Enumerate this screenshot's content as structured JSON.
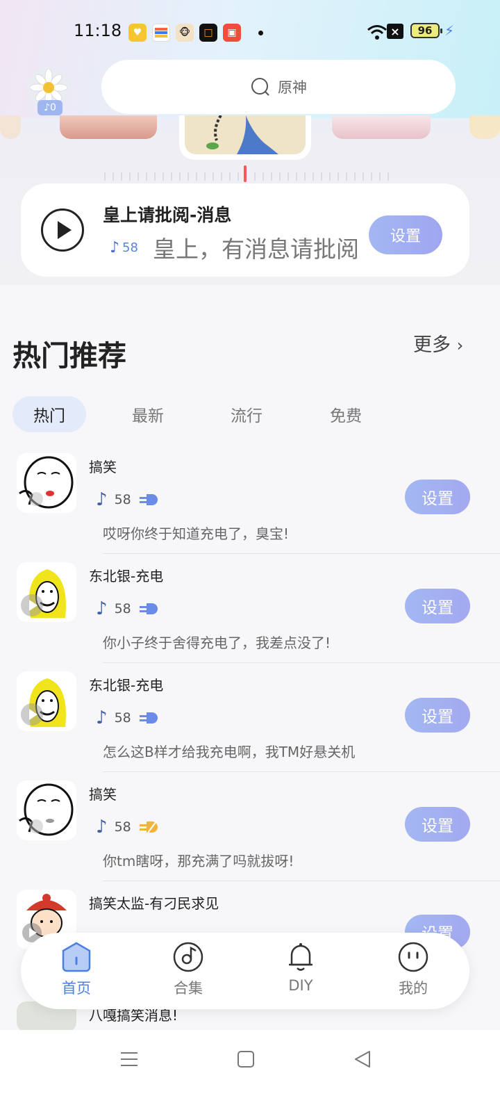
{
  "status_bar": {
    "time": "11:18",
    "battery": "96"
  },
  "avatar": {
    "badge_count": "0"
  },
  "search": {
    "placeholder": "原神"
  },
  "now_playing": {
    "title": "皇上请批阅-消息",
    "count": "58",
    "subtitle": "皇上，有消息请批阅",
    "set_label": "设置"
  },
  "section": {
    "title": "热门推荐",
    "more_label": "更多"
  },
  "tabs": [
    "热门",
    "最新",
    "流行",
    "免费"
  ],
  "list": [
    {
      "name": "搞笑",
      "count": "58",
      "desc": "哎呀你终于知道充电了，臭宝!",
      "set_label": "设置",
      "plug_color": "#6b8be8",
      "art": "meme-face"
    },
    {
      "name": "东北银-充电",
      "count": "58",
      "desc": "你小子终于舍得充电了，我差点没了!",
      "set_label": "设置",
      "plug_color": "#6b8be8",
      "art": "yellow-hair"
    },
    {
      "name": "东北银-充电",
      "count": "58",
      "desc": "怎么这B样才给我充电啊，我TM好悬关机",
      "set_label": "设置",
      "plug_color": "#6b8be8",
      "art": "yellow-hair"
    },
    {
      "name": "搞笑",
      "count": "58",
      "desc": "你tm瞎呀，那充满了吗就拔呀!",
      "set_label": "设置",
      "plug_color": "#f0b43c",
      "art": "meme-face"
    },
    {
      "name": "搞笑太监-有刁民求见",
      "count": "",
      "desc": "",
      "set_label": "设置",
      "plug_color": "#6b8be8",
      "art": "eunuch"
    },
    {
      "name": "八嘎搞笑消息!",
      "count": "",
      "desc": "",
      "set_label": "",
      "plug_color": "#6b8be8",
      "art": "cat"
    }
  ],
  "bottom_nav": [
    {
      "label": "首页",
      "icon": "home-icon",
      "active": true
    },
    {
      "label": "合集",
      "icon": "music-disc-icon",
      "active": false
    },
    {
      "label": "DIY",
      "icon": "bell-icon",
      "active": false
    },
    {
      "label": "我的",
      "icon": "smiley-icon",
      "active": false
    }
  ],
  "colors": {
    "accent": "#4b7fe0",
    "button": "#a3b7f2"
  }
}
